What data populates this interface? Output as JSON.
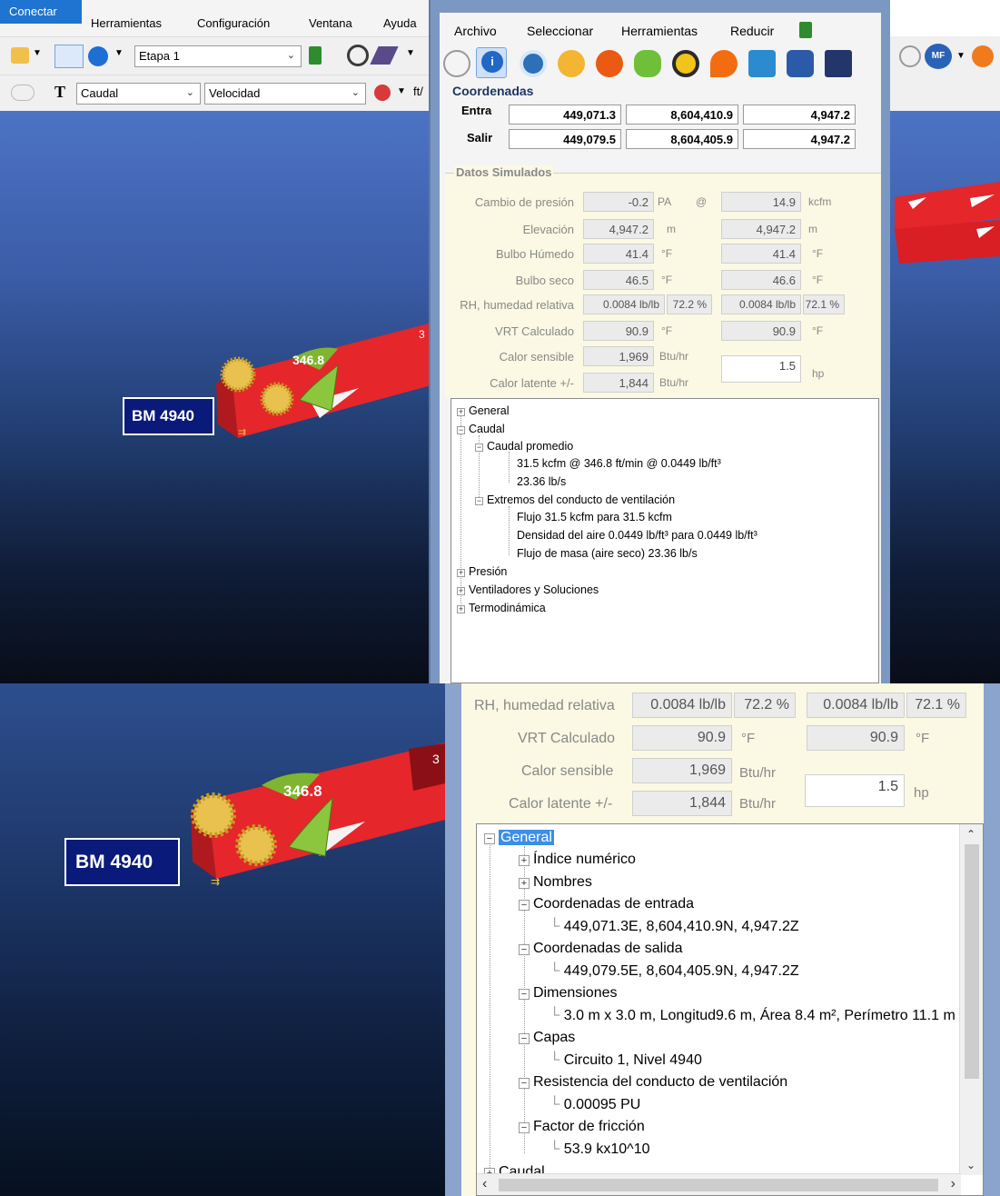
{
  "app": {
    "menu": [
      "Conectar",
      "Herramientas",
      "Configuración",
      "Ventana",
      "Ayuda"
    ],
    "toolbar": {
      "stage_value": "Etapa 1",
      "text_tool": "T",
      "combo_left": "Caudal",
      "combo_right": "Velocidad",
      "unit_fragment": "ft/"
    }
  },
  "scene": {
    "label": "BM 4940",
    "arrow_value": "346.8",
    "digit_fragment": "3"
  },
  "window": {
    "menu": [
      "Archivo",
      "Seleccionar",
      "Herramientas",
      "Reducir"
    ],
    "coordinates": {
      "title": "Coordenadas",
      "entrada_label": "Entra",
      "salida_label": "Salir",
      "entrada": [
        "449,071.3",
        "8,604,410.9",
        "4,947.2"
      ],
      "salida": [
        "449,079.5",
        "8,604,405.9",
        "4,947.2"
      ]
    },
    "datos_simulados": {
      "title": "Datos Simulados",
      "cambio_presion": {
        "label": "Cambio de presión",
        "value": "-0.2",
        "unit": "PA",
        "at": "@",
        "value2": "14.9",
        "unit2": "kcfm"
      },
      "elevacion": {
        "label": "Elevación",
        "value": "4,947.2",
        "unit": "m",
        "value2": "4,947.2",
        "unit2": "m"
      },
      "bulbo_humedo": {
        "label": "Bulbo Húmedo",
        "value": "41.4",
        "unit": "°F",
        "value2": "41.4",
        "unit2": "°F"
      },
      "bulbo_seco": {
        "label": "Bulbo seco",
        "value": "46.5",
        "unit": "°F",
        "value2": "46.6",
        "unit2": "°F"
      },
      "rh": {
        "label": "RH, humedad relativa",
        "value": "0.0084 lb/lb",
        "pct": "72.2 %",
        "value2": "0.0084 lb/lb",
        "pct2": "72.1 %"
      },
      "vrt": {
        "label": "VRT Calculado",
        "value": "90.9",
        "unit": "°F",
        "value2": "90.9",
        "unit2": "°F"
      },
      "calor_sensible": {
        "label": "Calor sensible",
        "value": "1,969",
        "unit": "Btu/hr"
      },
      "calor_latente": {
        "label": "Calor latente +/-",
        "value": "1,844",
        "unit": "Btu/hr",
        "hp_value": "1.5",
        "hp_unit": "hp"
      }
    },
    "tree_top": [
      {
        "text": "General",
        "box": "+"
      },
      {
        "text": "Caudal",
        "box": "−"
      },
      {
        "text": "Caudal promedio",
        "box": "−"
      },
      {
        "text": "31.5 kcfm  @  346.8 ft/min  @  0.0449 lb/ft³"
      },
      {
        "text": "23.36 lb/s"
      },
      {
        "text": "Extremos del conducto de ventilación",
        "box": "−"
      },
      {
        "text": "Flujo    31.5 kcfm  para 31.5 kcfm"
      },
      {
        "text": "Densidad del aire 0.0449 lb/ft³  para 0.0449 lb/ft³"
      },
      {
        "text": "Flujo de masa (aire seco)  23.36 lb/s"
      },
      {
        "text": "Presión",
        "box": "+"
      },
      {
        "text": "Ventiladores y Soluciones",
        "box": "+"
      },
      {
        "text": "Termodinámica",
        "box": "+"
      }
    ],
    "tree_bottom": [
      {
        "text": "General",
        "box": "−"
      },
      {
        "text": "Índice numérico",
        "box": "+"
      },
      {
        "text": "Nombres",
        "box": "+"
      },
      {
        "text": "Coordenadas de entrada",
        "box": "−"
      },
      {
        "text": "449,071.3E, 8,604,410.9N, 4,947.2Z"
      },
      {
        "text": "Coordenadas de salida",
        "box": "−"
      },
      {
        "text": "449,079.5E, 8,604,405.9N, 4,947.2Z"
      },
      {
        "text": "Dimensiones",
        "box": "−"
      },
      {
        "text": "3.0 m x 3.0 m, Longitud9.6 m, Área 8.4 m², Perímetro 11.1 m"
      },
      {
        "text": "Capas",
        "box": "−"
      },
      {
        "text": "Circuito 1,  Nivel 4940"
      },
      {
        "text": "Resistencia del conducto de ventilación",
        "box": "−"
      },
      {
        "text": "0.00095 PU"
      },
      {
        "text": "Factor de fricción",
        "box": "−"
      },
      {
        "text": "53.9 kx10^10"
      },
      {
        "text": "Caudal",
        "box": "+"
      }
    ],
    "icon_names": [
      "back-icon",
      "info-icon",
      "fan-icon",
      "sun-icon",
      "fire-icon",
      "leaf-icon",
      "radiation-icon",
      "flame-icon",
      "signal-icon",
      "disk-icon",
      "vl-icon"
    ]
  }
}
